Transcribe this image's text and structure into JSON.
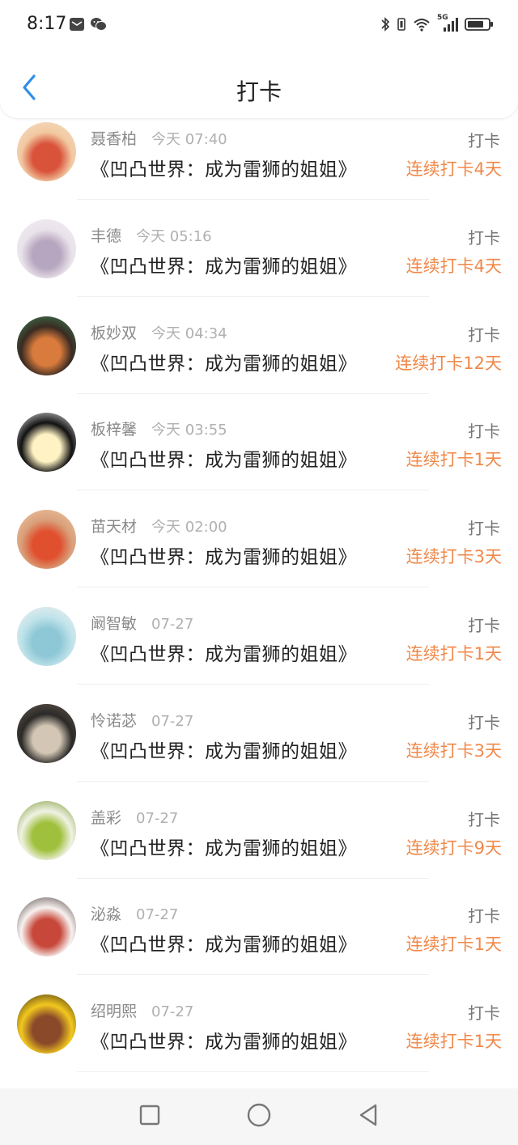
{
  "status_bar": {
    "time": "8:17",
    "left_icons": [
      "mail-icon",
      "wechat-icon"
    ],
    "right_icons": [
      "bluetooth-icon",
      "vibrate-icon",
      "wifi-icon",
      "signal-5g-icon",
      "battery-icon"
    ],
    "network_label": "5G"
  },
  "header": {
    "title": "打卡",
    "back_icon": "chevron-left-icon"
  },
  "colors": {
    "accent_back": "#2f8ee9",
    "streak": "#f0894a"
  },
  "checkins": [
    {
      "name": "聂香柏",
      "time": "今天 07:40",
      "book": "《凹凸世界：成为雷狮的姐姐》",
      "action": "打卡",
      "streak": "连续打卡4天",
      "avatar_colors": [
        "#f1c8a0",
        "#d9523a",
        "#f6e1c9"
      ]
    },
    {
      "name": "丰德",
      "time": "今天 05:16",
      "book": "《凹凸世界：成为雷狮的姐姐》",
      "action": "打卡",
      "streak": "连续打卡4天",
      "avatar_colors": [
        "#e9e2ea",
        "#b7a6bf",
        "#f4eef3"
      ]
    },
    {
      "name": "板妙双",
      "time": "今天 04:34",
      "book": "《凹凸世界：成为雷狮的姐姐》",
      "action": "打卡",
      "streak": "连续打卡12天",
      "avatar_colors": [
        "#3a2b22",
        "#d97b3c",
        "#3b8a5a"
      ]
    },
    {
      "name": "板梓馨",
      "time": "今天 03:55",
      "book": "《凹凸世界：成为雷狮的姐姐》",
      "action": "打卡",
      "streak": "连续打卡1天",
      "avatar_colors": [
        "#111111",
        "#fff3c4",
        "#ffffff"
      ]
    },
    {
      "name": "苗天材",
      "time": "今天 02:00",
      "book": "《凹凸世界：成为雷狮的姐姐》",
      "action": "打卡",
      "streak": "连续打卡3天",
      "avatar_colors": [
        "#d8a07a",
        "#e0502f",
        "#f2c9a8"
      ]
    },
    {
      "name": "阚智敏",
      "time": "07-27",
      "book": "《凹凸世界：成为雷狮的姐姐》",
      "action": "打卡",
      "streak": "连续打卡1天",
      "avatar_colors": [
        "#bfe3ea",
        "#8ec7d6",
        "#f5f2ee"
      ]
    },
    {
      "name": "怜诺苾",
      "time": "07-27",
      "book": "《凹凸世界：成为雷狮的姐姐》",
      "action": "打卡",
      "streak": "连续打卡3天",
      "avatar_colors": [
        "#2b2a28",
        "#d3c6b4",
        "#6a5d50"
      ]
    },
    {
      "name": "盖彩",
      "time": "07-27",
      "book": "《凹凸世界：成为雷狮的姐姐》",
      "action": "打卡",
      "streak": "连续打卡9天",
      "avatar_colors": [
        "#f0f2e4",
        "#9fc03c",
        "#6f8f22"
      ]
    },
    {
      "name": "泌淼",
      "time": "07-27",
      "book": "《凹凸世界：成为雷狮的姐姐》",
      "action": "打卡",
      "streak": "连续打卡1天",
      "avatar_colors": [
        "#f7f2f0",
        "#c7483a",
        "#3b2b2b"
      ]
    },
    {
      "name": "绍明熙",
      "time": "07-27",
      "book": "《凹凸世界：成为雷狮的姐姐》",
      "action": "打卡",
      "streak": "连续打卡1天",
      "avatar_colors": [
        "#f2c81e",
        "#8a4a2a",
        "#2a1a12"
      ]
    }
  ],
  "nav_bar": {
    "buttons": [
      "square-recent-icon",
      "circle-home-icon",
      "triangle-back-icon"
    ]
  }
}
